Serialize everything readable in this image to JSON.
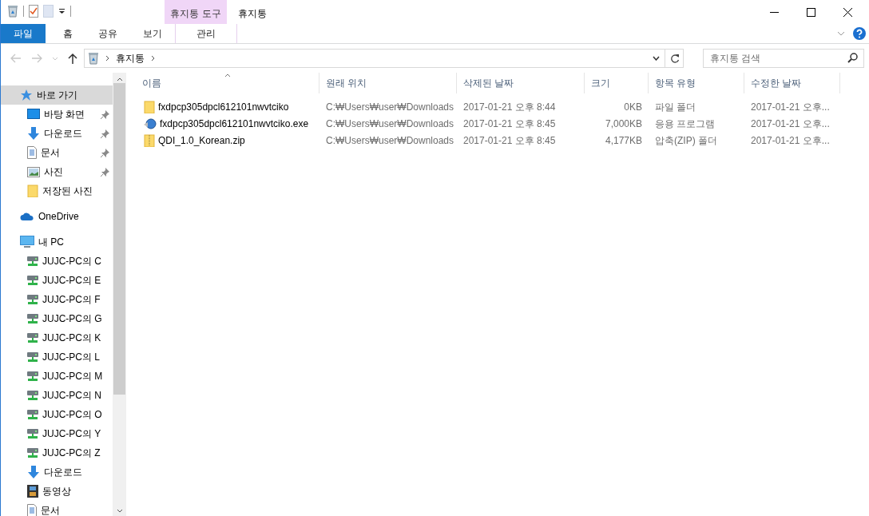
{
  "window": {
    "title": "휴지통"
  },
  "ribbon": {
    "context_group": "휴지통 도구",
    "tabs": [
      {
        "label": "파일",
        "kind": "file"
      },
      {
        "label": "홈",
        "kind": "tab"
      },
      {
        "label": "공유",
        "kind": "tab"
      },
      {
        "label": "보기",
        "kind": "tab"
      },
      {
        "label": "관리",
        "kind": "context"
      }
    ]
  },
  "address": {
    "path": [
      "휴지통"
    ],
    "search_placeholder": "휴지통 검색"
  },
  "sidebar": {
    "items": [
      {
        "label": "바로 가기",
        "kind": "quick",
        "selected": true,
        "children": [
          {
            "label": "바탕 화면",
            "kind": "desktop",
            "pinned": true,
            "selected": false
          },
          {
            "label": "다운로드",
            "kind": "download",
            "pinned": true,
            "selected": false
          },
          {
            "label": "문서",
            "kind": "doc",
            "pinned": true,
            "selected": false
          },
          {
            "label": "사진",
            "kind": "picture",
            "pinned": true,
            "selected": false
          },
          {
            "label": "저장된 사진",
            "kind": "folder",
            "pinned": false,
            "selected": false
          }
        ]
      },
      {
        "label": "OneDrive",
        "kind": "cloud",
        "selected": false
      },
      {
        "label": "내 PC",
        "kind": "pc",
        "selected": false,
        "children": [
          {
            "label": "JUJC-PC의 C",
            "kind": "drive",
            "selected": false
          },
          {
            "label": "JUJC-PC의 E",
            "kind": "drive",
            "selected": false
          },
          {
            "label": "JUJC-PC의 F",
            "kind": "drive",
            "selected": false
          },
          {
            "label": "JUJC-PC의 G",
            "kind": "drive",
            "selected": false
          },
          {
            "label": "JUJC-PC의 K",
            "kind": "drive",
            "selected": false
          },
          {
            "label": "JUJC-PC의 L",
            "kind": "drive",
            "selected": false
          },
          {
            "label": "JUJC-PC의 M",
            "kind": "drive",
            "selected": false
          },
          {
            "label": "JUJC-PC의 N",
            "kind": "drive",
            "selected": false
          },
          {
            "label": "JUJC-PC의 O",
            "kind": "drive",
            "selected": false
          },
          {
            "label": "JUJC-PC의 Y",
            "kind": "drive",
            "selected": false
          },
          {
            "label": "JUJC-PC의 Z",
            "kind": "drive",
            "selected": false
          },
          {
            "label": "다운로드",
            "kind": "download",
            "selected": false
          },
          {
            "label": "동영상",
            "kind": "video",
            "selected": false
          },
          {
            "label": "문서",
            "kind": "doc",
            "selected": false
          }
        ]
      }
    ]
  },
  "table": {
    "columns": [
      {
        "label": "이름",
        "sorted": true
      },
      {
        "label": "원래 위치",
        "sorted": false
      },
      {
        "label": "삭제된 날짜",
        "sorted": false
      },
      {
        "label": "크기",
        "sorted": false
      },
      {
        "label": "항목 유형",
        "sorted": false
      },
      {
        "label": "수정한 날짜",
        "sorted": false
      }
    ],
    "rows": [
      {
        "kind": "folder",
        "cells": [
          "fxdpcp305dpcl612101nwvtciko",
          "C:₩Users₩user₩Downloads",
          "2017-01-21 오후 8:44",
          "0KB",
          "파일 폴더",
          "2017-01-21 오후..."
        ]
      },
      {
        "kind": "exe",
        "cells": [
          "fxdpcp305dpcl612101nwvtciko.exe",
          "C:₩Users₩user₩Downloads",
          "2017-01-21 오후 8:45",
          "7,000KB",
          "응용 프로그램",
          "2017-01-21 오후..."
        ]
      },
      {
        "kind": "zip",
        "cells": [
          "QDI_1.0_Korean.zip",
          "C:₩Users₩user₩Downloads",
          "2017-01-21 오후 8:45",
          "4,177KB",
          "압축(ZIP) 폴더",
          "2017-01-21 오후..."
        ]
      }
    ]
  }
}
